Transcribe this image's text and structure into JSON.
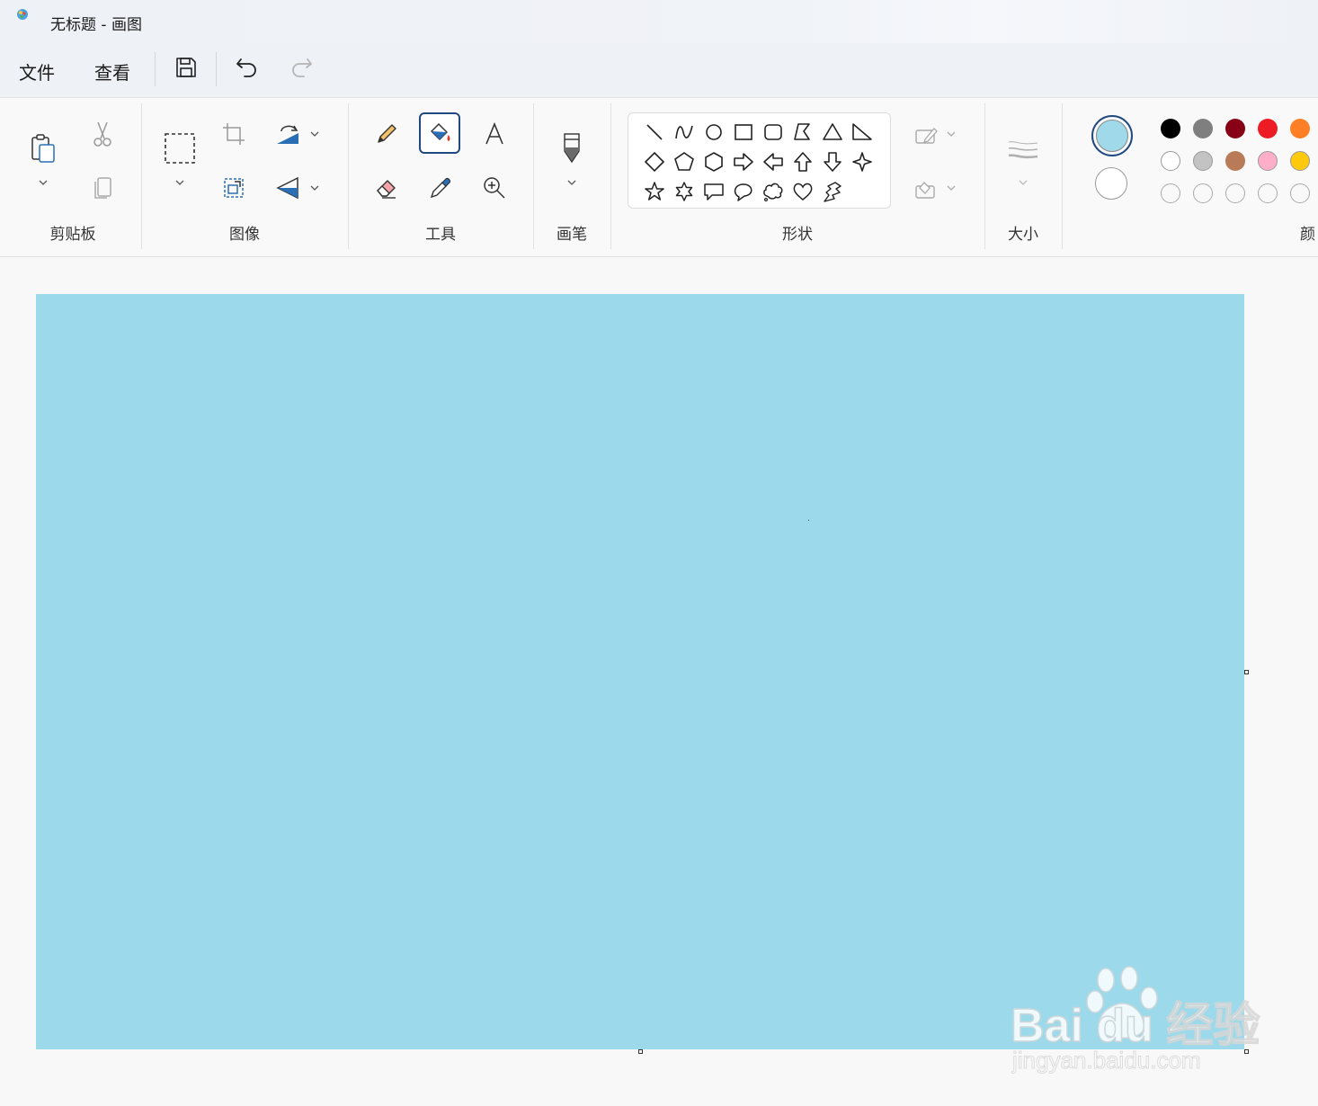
{
  "window": {
    "title": "无标题 - 画图"
  },
  "menu": {
    "file": "文件",
    "view": "查看"
  },
  "quick_access": {
    "save": "save-icon",
    "undo": "undo-icon",
    "redo": "redo-icon"
  },
  "ribbon": {
    "groups": {
      "clipboard": "剪贴板",
      "image": "图像",
      "tools": "工具",
      "brushes": "画笔",
      "shapes": "形状",
      "size": "大小",
      "colors": "颜"
    }
  },
  "colors": {
    "primary": "#9fd9ea",
    "secondary": "#ffffff",
    "palette_row1": [
      "#000000",
      "#7f7f7f",
      "#880015",
      "#ed1c24",
      "#ff7f27"
    ],
    "palette_row2": [
      "#ffffff",
      "#c3c3c3",
      "#b97a57",
      "#ffaec9",
      "#ffc90e"
    ],
    "canvas_fill": "#9cd9ea",
    "accent": "#1f4a80"
  },
  "watermark": {
    "brand": "Bai du 经验",
    "url": "jingyan.baidu.com"
  }
}
